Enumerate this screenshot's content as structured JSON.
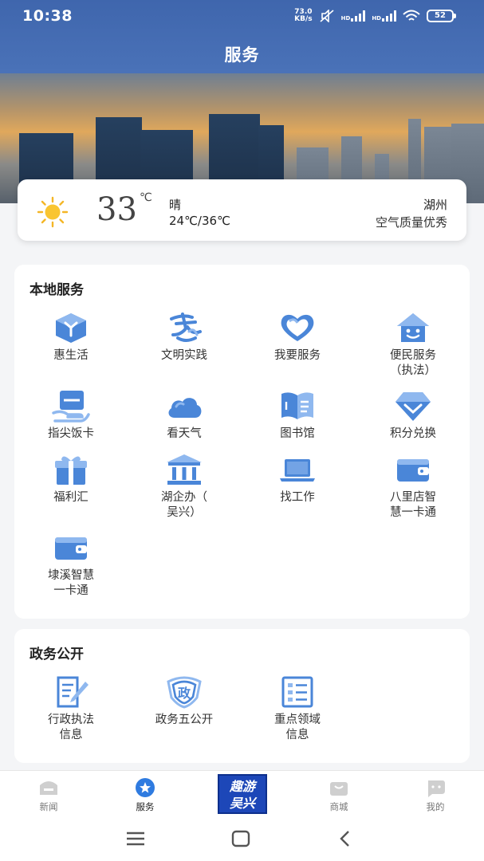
{
  "status": {
    "time": "10:38",
    "net_speed_value": "73.0",
    "net_speed_unit": "KB/s",
    "hd1": "HD",
    "hd2": "HD",
    "battery": "52"
  },
  "header": {
    "title": "服务"
  },
  "weather": {
    "icon": "sun-icon",
    "temperature": "33",
    "unit": "℃",
    "condition": "晴",
    "range": "24℃/36℃",
    "city": "湖州",
    "air_quality": "空气质量优秀"
  },
  "local_services": {
    "title": "本地服务",
    "items": [
      {
        "label": "惠生活",
        "icon": "cube-icon"
      },
      {
        "label": "文明实践",
        "icon": "calligraphy-icon"
      },
      {
        "label": "我要服务",
        "icon": "heart-icon"
      },
      {
        "label": "便民服务\n（执法）",
        "icon": "smiling-house-icon"
      },
      {
        "label": "指尖饭卡",
        "icon": "card-in-hand-icon"
      },
      {
        "label": "看天气",
        "icon": "cloud-icon"
      },
      {
        "label": "图书馆",
        "icon": "book-icon"
      },
      {
        "label": "积分兑换",
        "icon": "diamond-icon"
      },
      {
        "label": "福利汇",
        "icon": "gift-icon"
      },
      {
        "label": "湖企办（\n吴兴）",
        "icon": "government-building-icon"
      },
      {
        "label": "找工作",
        "icon": "laptop-icon"
      },
      {
        "label": "八里店智\n慧一卡通",
        "icon": "wallet-icon"
      },
      {
        "label": "埭溪智慧\n一卡通",
        "icon": "wallet-icon"
      }
    ]
  },
  "gov_affairs": {
    "title": "政务公开",
    "items": [
      {
        "label": "行政执法\n信息",
        "icon": "document-pen-icon"
      },
      {
        "label": "政务五公开",
        "icon": "gov-badge-icon",
        "badge_text": "政"
      },
      {
        "label": "重点领域\n信息",
        "icon": "list-document-icon"
      }
    ]
  },
  "bottom_nav": {
    "items": [
      {
        "label": "新闻",
        "icon": "news-icon",
        "active": false
      },
      {
        "label": "服务",
        "icon": "star-icon",
        "active": true
      },
      {
        "label": "商城",
        "icon": "shopping-bag-icon",
        "active": false
      },
      {
        "label": "我的",
        "icon": "profile-icon",
        "active": false
      }
    ],
    "promo": {
      "line1": "趣游",
      "line2": "吴兴"
    }
  },
  "colors": {
    "header": "#4a72b8",
    "icon_blue": "#4a86d8",
    "icon_light": "#8fb8ef"
  }
}
